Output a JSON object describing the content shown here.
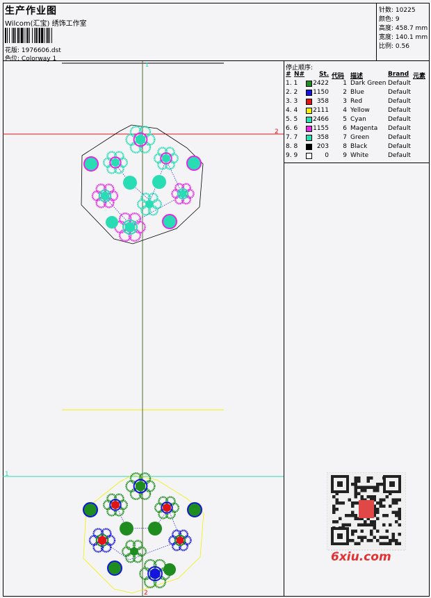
{
  "header": {
    "title": "生产作业图",
    "company": "Wilcom(汇宝) 绣饰工作室",
    "design_label": "花版:",
    "design_value": "1976606.dst",
    "colorway_label": "色位:",
    "colorway_value": "Colorway 1"
  },
  "stats": {
    "stitches_label": "针数:",
    "stitches_value": "10225",
    "colors_label": "颜色:",
    "colors_value": "9",
    "height_label": "高度:",
    "height_value": "458.7 mm",
    "width_label": "宽度:",
    "width_value": "140.1 mm",
    "scale_label": "比例:",
    "scale_value": "0.56"
  },
  "stop_sequence": {
    "title": "停止顺序:",
    "headers": {
      "hash": "#",
      "n": "N#",
      "st": "St.",
      "code": "代码",
      "desc": "描述",
      "brand": "Brand",
      "element": "元素"
    },
    "rows": [
      {
        "idx": "1. 1",
        "color": "#1e8c1e",
        "st": "2422",
        "code": "1",
        "desc": "Dark Green",
        "brand": "Default"
      },
      {
        "idx": "2. 2",
        "color": "#1414dc",
        "st": "1150",
        "code": "2",
        "desc": "Blue",
        "brand": "Default"
      },
      {
        "idx": "3. 3",
        "color": "#e01414",
        "st": "358",
        "code": "3",
        "desc": "Red",
        "brand": "Default"
      },
      {
        "idx": "4. 4",
        "color": "#f0f000",
        "st": "2111",
        "code": "4",
        "desc": "Yellow",
        "brand": "Default"
      },
      {
        "idx": "5. 5",
        "color": "#28dcb4",
        "st": "2466",
        "code": "5",
        "desc": "Cyan",
        "brand": "Default"
      },
      {
        "idx": "6. 6",
        "color": "#e628e6",
        "st": "1155",
        "code": "6",
        "desc": "Magenta",
        "brand": "Default"
      },
      {
        "idx": "7. 7",
        "color": "#28dcb4",
        "st": "358",
        "code": "7",
        "desc": "Green",
        "brand": "Default"
      },
      {
        "idx": "8. 8",
        "color": "#000000",
        "st": "203",
        "code": "8",
        "desc": "Black",
        "brand": "Default"
      },
      {
        "idx": "9. 9",
        "color": "#ffffff",
        "st": "0",
        "code": "9",
        "desc": "White",
        "brand": "Default"
      }
    ]
  },
  "canvas": {
    "marker_1": "1",
    "marker_2": "2",
    "marker_top": "1"
  },
  "watermark": {
    "text": "6xiu.com"
  }
}
